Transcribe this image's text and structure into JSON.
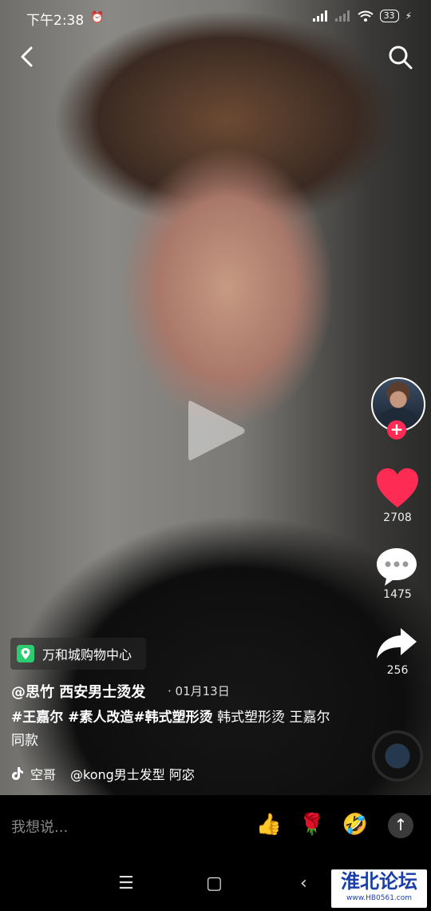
{
  "status": {
    "time": "下午2:38",
    "battery": "33"
  },
  "creator": {
    "follow_symbol": "+"
  },
  "stats": {
    "likes": "2708",
    "comments": "1475",
    "shares": "256"
  },
  "location": {
    "label": "万和城购物中心"
  },
  "post": {
    "author": "@思竹 西安男士烫发",
    "date": "· 01月13日",
    "hashtags": "#王嘉尔 #素人改造#韩式塑形烫",
    "caption_rest": "韩式塑形烫 王嘉尔同款"
  },
  "music": {
    "author": "空哥",
    "title": "@kong男士发型 阿宓"
  },
  "comment_box": {
    "placeholder": "我想说..."
  },
  "emojis": {
    "thumbs": "👍",
    "rose": "🌹",
    "laugh": "🤣"
  },
  "send_symbol": "↑",
  "nav": {
    "menu": "☰",
    "home": "▢",
    "back": "‹"
  },
  "watermark": {
    "title": "淮北论坛",
    "url": "www.HB0561.com"
  },
  "colors": {
    "like": "#fe2c55",
    "location_pin": "#2ecc71",
    "watermark": "#1b3fa8"
  }
}
